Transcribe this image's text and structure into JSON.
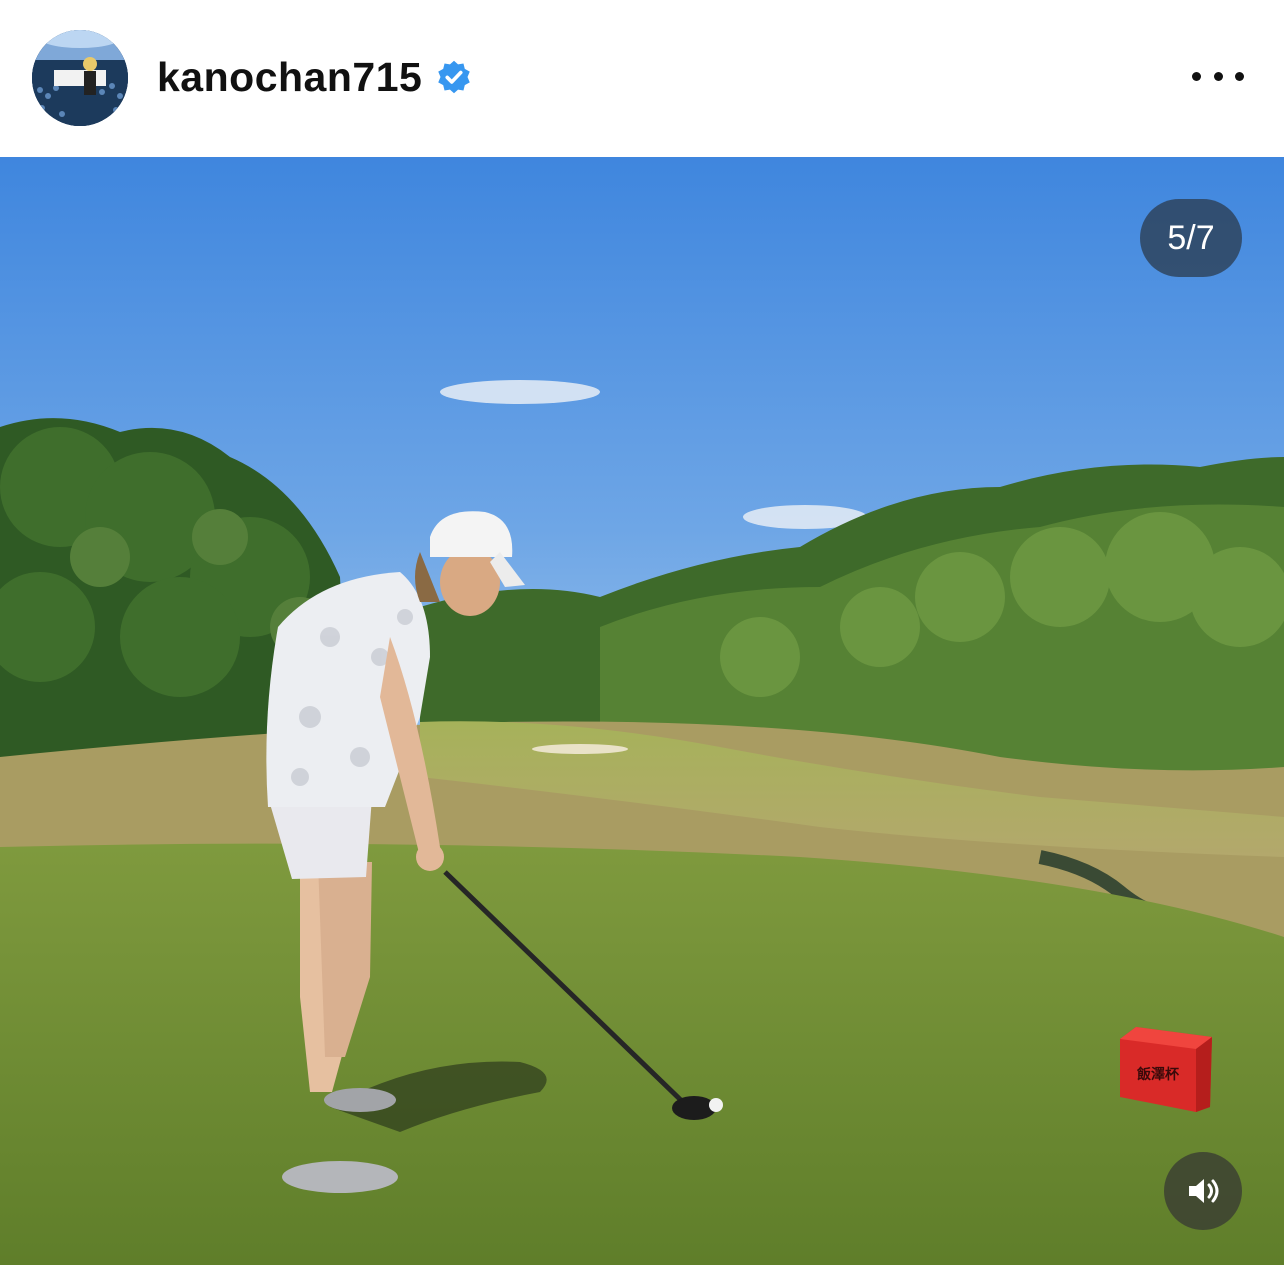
{
  "post": {
    "username": "kanochan715",
    "verified": true,
    "more_icon": "more-horizontal-icon",
    "avatar_icon": "profile-avatar"
  },
  "media": {
    "counter": "5/7",
    "tee_marker_text": "飯澤杯",
    "sound_icon": "speaker-icon"
  },
  "colors": {
    "verified_badge": "#3797f0",
    "counter_bg": "#2c3e52",
    "sky": "#5f9ae0",
    "tee_box_red": "#e03030"
  }
}
